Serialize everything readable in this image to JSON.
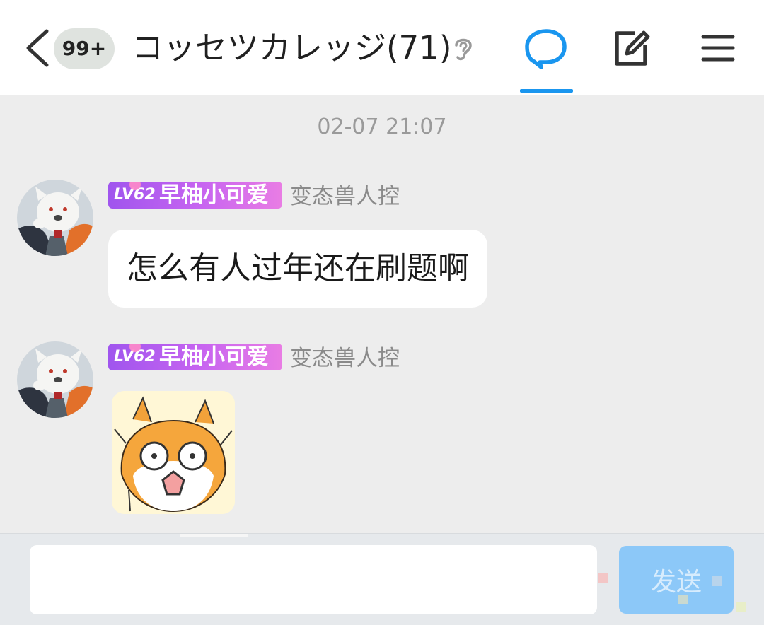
{
  "header": {
    "unread_badge": "99+",
    "group_title": "コッセツカレッジ(71)"
  },
  "conversation": {
    "timestamp": "02-07 21:07",
    "messages": [
      {
        "sender": {
          "level": "LV62",
          "nickname": "早柚小可爱",
          "title": "变态兽人控"
        },
        "type": "text",
        "text": "怎么有人过年还在刷题啊"
      },
      {
        "sender": {
          "level": "LV62",
          "nickname": "早柚小可爱",
          "title": "变态兽人控"
        },
        "type": "sticker",
        "sticker_icon": "shocked-fox-sticker"
      }
    ]
  },
  "input_bar": {
    "placeholder": "",
    "send_label": "发送"
  },
  "colors": {
    "accent": "#1a96ef",
    "background": "#ededed",
    "badge_gradient_start": "#a055ee",
    "badge_gradient_end": "#e97de4",
    "send_button": "#8cc8f8"
  },
  "icons": {
    "back": "back-arrow-icon",
    "ear": "ear-icon",
    "chat": "chat-bubble-icon",
    "compose": "compose-icon",
    "menu": "menu-icon"
  }
}
